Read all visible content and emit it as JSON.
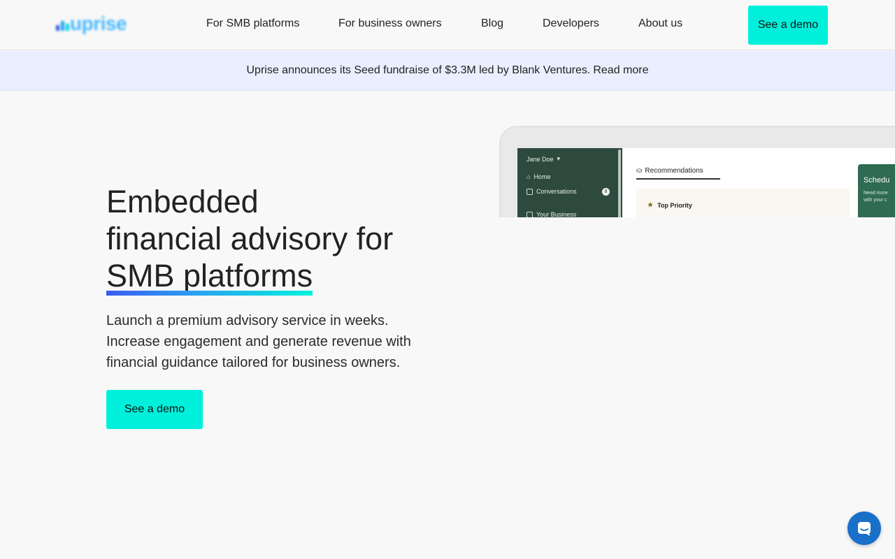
{
  "brand": {
    "name": "uprise",
    "accent": "#00f0db",
    "logo_color": "#4ab8ff"
  },
  "nav": {
    "links": [
      "For SMB platforms",
      "For business owners",
      "Blog",
      "Developers",
      "About us"
    ],
    "cta": "See a demo"
  },
  "banner": {
    "text": "Uprise announces its Seed fundraise of $3.3M led by Blank Ventures.",
    "link": "Read more",
    "background": "#eaefff"
  },
  "hero": {
    "title_line1": "Embedded",
    "title_line2": "financial advisory for",
    "title_highlight": "SMB platforms",
    "subtitle": "Launch a premium advisory service in weeks. Increase engagement and generate revenue with financial guidance tailored for business owners.",
    "cta": "See a demo"
  },
  "mockup": {
    "user": "Jane Doe",
    "sidebar": [
      "Home",
      "Conversations",
      "Your Business"
    ],
    "badge": "8",
    "tab": "Recommendations",
    "card_title": "Top Priority",
    "side_card_title": "Schedu",
    "side_card_text": "Need more\nwith your c"
  },
  "chat": {
    "icon": "chat-icon",
    "color": "#1a6fc9"
  }
}
